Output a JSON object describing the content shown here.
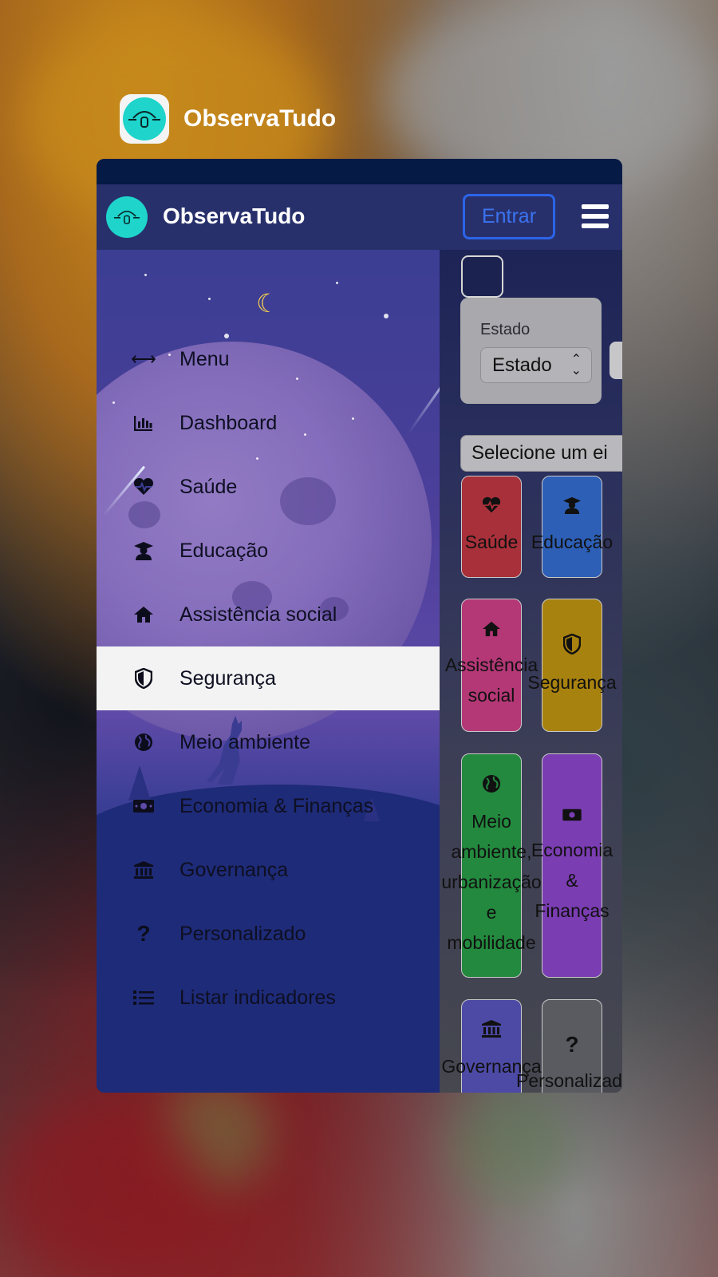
{
  "app_switcher": {
    "app_name": "ObservaTudo"
  },
  "navbar": {
    "title": "ObservaTudo",
    "login_label": "Entrar"
  },
  "sidebar": {
    "items": [
      {
        "label": "Menu",
        "icon": "arrows-horizontal-icon"
      },
      {
        "label": "Dashboard",
        "icon": "bar-chart-icon"
      },
      {
        "label": "Saúde",
        "icon": "heart-pulse-icon"
      },
      {
        "label": "Educação",
        "icon": "graduate-icon"
      },
      {
        "label": "Assistência social",
        "icon": "home-icon"
      },
      {
        "label": "Segurança",
        "icon": "shield-icon",
        "active": true
      },
      {
        "label": "Meio ambiente",
        "icon": "globe-icon"
      },
      {
        "label": "Economia & Finanças",
        "icon": "money-icon"
      },
      {
        "label": "Governança",
        "icon": "bank-icon"
      },
      {
        "label": "Personalizado",
        "icon": "question-icon"
      },
      {
        "label": "Listar indicadores",
        "icon": "list-icon"
      }
    ]
  },
  "filters": {
    "state_label": "Estado",
    "state_value": "Estado",
    "eixo_placeholder": "Selecione um ei"
  },
  "tiles": [
    {
      "label": "Saúde",
      "icon": "heart-pulse-icon",
      "color": "#a8303a"
    },
    {
      "label": "Educação",
      "icon": "graduate-icon",
      "color": "#2d5fb6"
    },
    {
      "label": "Assistência\nsocial",
      "icon": "home-icon",
      "color": "#b43776"
    },
    {
      "label": "Segurança",
      "icon": "shield-icon",
      "color": "#a8820f"
    },
    {
      "label": "Meio\nambiente,\nurbanização\ne\nmobilidade",
      "icon": "globe-icon",
      "color": "#23893e"
    },
    {
      "label": "Economia\n&\nFinanças",
      "icon": "money-icon",
      "color": "#7a3db2"
    },
    {
      "label": "Governança\ne\nTransparência",
      "icon": "bank-icon",
      "color": "#4d4aa6"
    },
    {
      "label": "Personalizado",
      "icon": "question-icon",
      "color": "#595b60"
    }
  ]
}
